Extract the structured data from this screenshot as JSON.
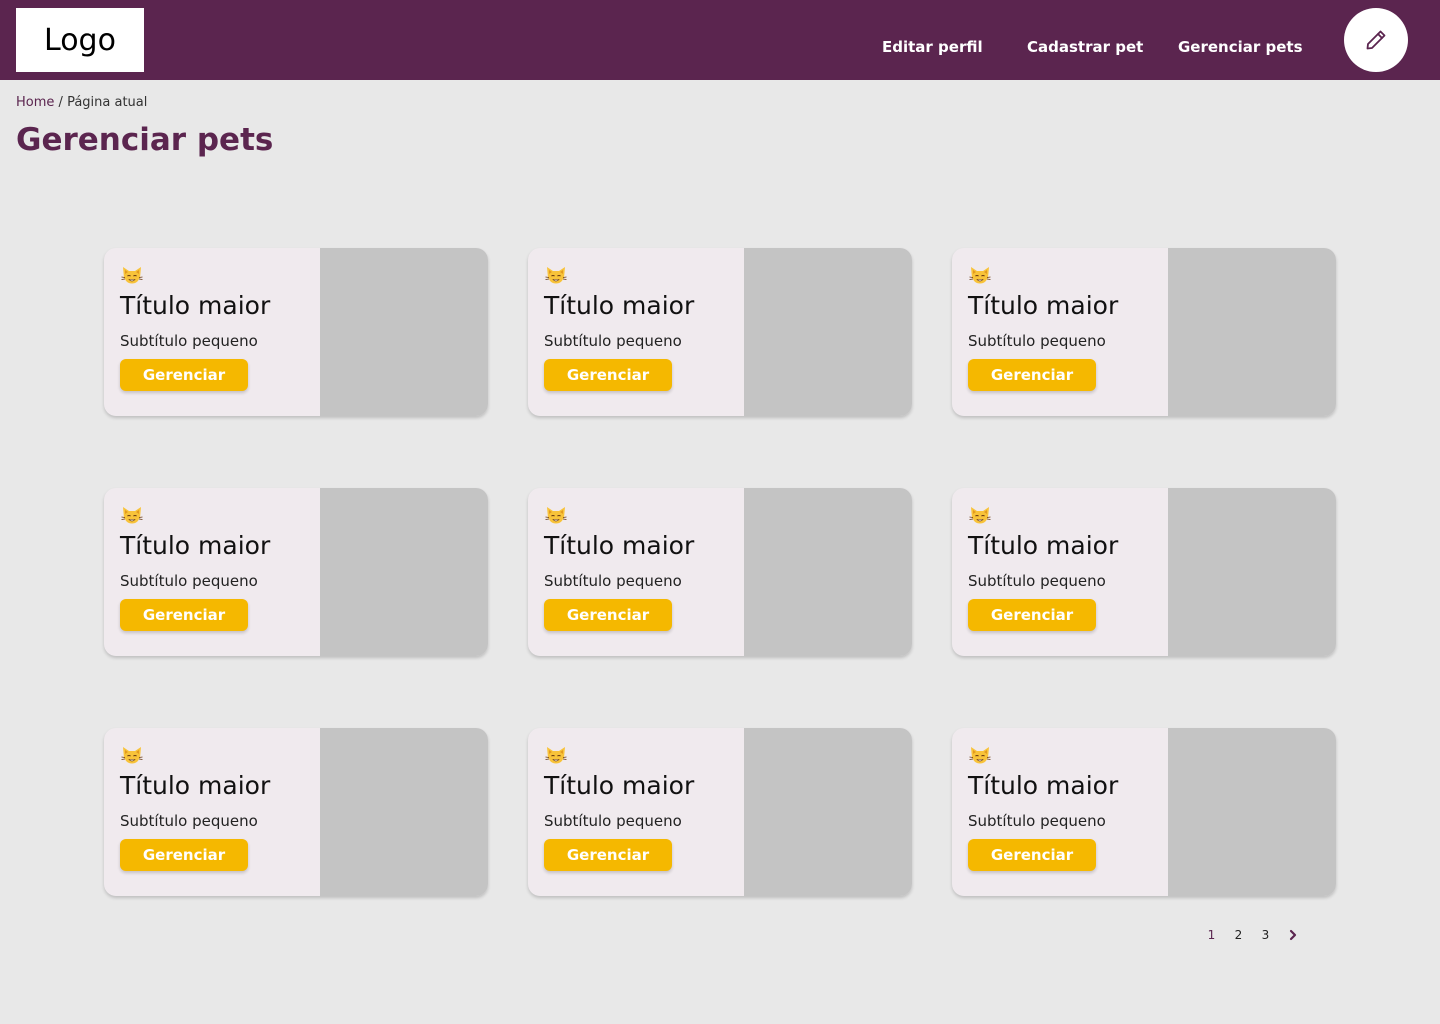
{
  "header": {
    "logo": "Logo",
    "nav": [
      "Editar perfil",
      "Cadastrar pet",
      "Gerenciar pets"
    ],
    "edit_icon": "pencil-icon"
  },
  "breadcrumb": {
    "home": "Home",
    "separator": "/",
    "current": "Página atual"
  },
  "page": {
    "title": "Gerenciar pets"
  },
  "cards": [
    {
      "icon": "cat-face-icon",
      "title": "Título maior",
      "subtitle": "Subtítulo pequeno",
      "button": "Gerenciar"
    },
    {
      "icon": "cat-face-icon",
      "title": "Título maior",
      "subtitle": "Subtítulo pequeno",
      "button": "Gerenciar"
    },
    {
      "icon": "cat-face-icon",
      "title": "Título maior",
      "subtitle": "Subtítulo pequeno",
      "button": "Gerenciar"
    },
    {
      "icon": "cat-face-icon",
      "title": "Título maior",
      "subtitle": "Subtítulo pequeno",
      "button": "Gerenciar"
    },
    {
      "icon": "cat-face-icon",
      "title": "Título maior",
      "subtitle": "Subtítulo pequeno",
      "button": "Gerenciar"
    },
    {
      "icon": "cat-face-icon",
      "title": "Título maior",
      "subtitle": "Subtítulo pequeno",
      "button": "Gerenciar"
    },
    {
      "icon": "cat-face-icon",
      "title": "Título maior",
      "subtitle": "Subtítulo pequeno",
      "button": "Gerenciar"
    },
    {
      "icon": "cat-face-icon",
      "title": "Título maior",
      "subtitle": "Subtítulo pequeno",
      "button": "Gerenciar"
    },
    {
      "icon": "cat-face-icon",
      "title": "Título maior",
      "subtitle": "Subtítulo pequeno",
      "button": "Gerenciar"
    }
  ],
  "pagination": {
    "pages": [
      "1",
      "2",
      "3"
    ],
    "current": "1",
    "next_icon": "chevron-right-icon"
  },
  "colors": {
    "brand": "#5b254f",
    "accent": "#f5b800",
    "card_bg": "#f0eaee",
    "image_placeholder": "#c4c4c4",
    "page_bg": "#e8e8e8"
  }
}
